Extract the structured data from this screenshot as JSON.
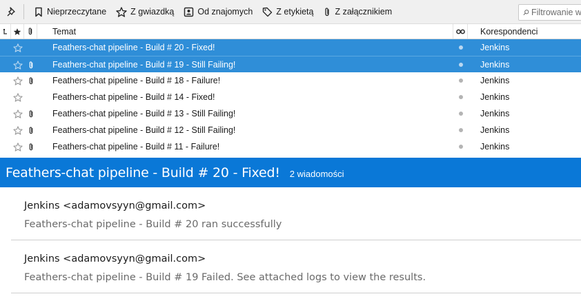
{
  "quick_filter": {
    "unread_label": "Nieprzeczytane",
    "starred_label": "Z gwiazdką",
    "contact_label": "Od znajomych",
    "tags_label": "Z etykietą",
    "attachment_label": "Z załącznikiem",
    "search_placeholder": "Filtrowanie w"
  },
  "columns": {
    "subject": "Temat",
    "correspondents": "Korespondenci"
  },
  "threads": [
    {
      "subject": "Feathers-chat pipeline - Build # 20 - Fixed!",
      "correspondent": "Jenkins",
      "has_attachment": false,
      "selected": true
    },
    {
      "subject": "Feathers-chat pipeline - Build # 19 - Still Failing!",
      "correspondent": "Jenkins",
      "has_attachment": true,
      "selected": true
    },
    {
      "subject": "Feathers-chat pipeline - Build # 18 - Failure!",
      "correspondent": "Jenkins",
      "has_attachment": true,
      "selected": false
    },
    {
      "subject": "Feathers-chat pipeline - Build # 14 - Fixed!",
      "correspondent": "Jenkins",
      "has_attachment": false,
      "selected": false
    },
    {
      "subject": "Feathers-chat pipeline - Build # 13 - Still Failing!",
      "correspondent": "Jenkins",
      "has_attachment": true,
      "selected": false
    },
    {
      "subject": "Feathers-chat pipeline - Build # 12 - Still Failing!",
      "correspondent": "Jenkins",
      "has_attachment": true,
      "selected": false
    },
    {
      "subject": "Feathers-chat pipeline - Build # 11 - Failure!",
      "correspondent": "Jenkins",
      "has_attachment": true,
      "selected": false
    }
  ],
  "summary": {
    "title": "Feathers-chat pipeline - Build # 20 - Fixed!",
    "count": "2 wiadomości",
    "messages": [
      {
        "from": "Jenkins <adamovsyyn@gmail.com>",
        "snippet": "Feathers-chat pipeline - Build # 20 ran successfully"
      },
      {
        "from": "Jenkins <adamovsyyn@gmail.com>",
        "snippet": "Feathers-chat pipeline - Build # 19 Failed. See attached logs to view the results."
      }
    ]
  },
  "colors": {
    "selection": "#2f8ed8",
    "summary_header": "#0a78d7"
  }
}
